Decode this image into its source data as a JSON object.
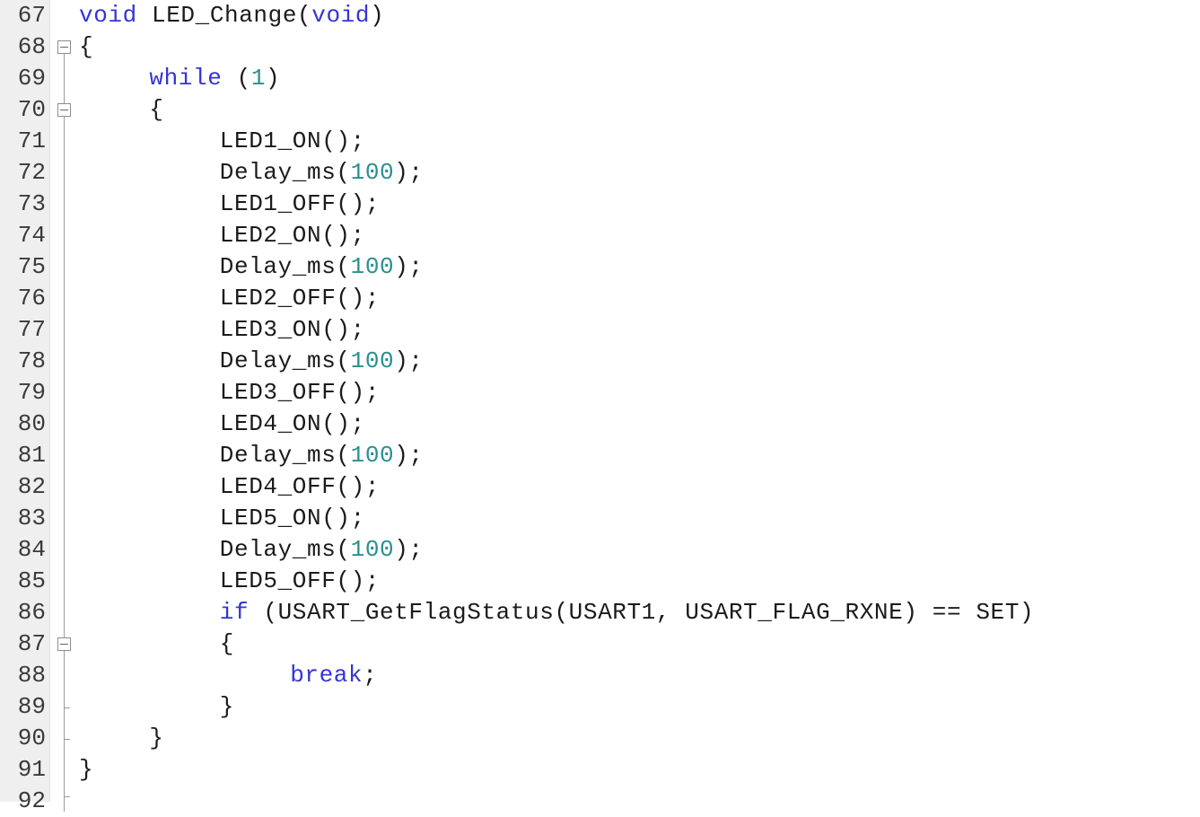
{
  "editor": {
    "title": "C source code editor view",
    "language": "C",
    "first_line": 67,
    "last_line": 92,
    "line_height": 35,
    "font_size": 26,
    "colors": {
      "background": "#ffffff",
      "gutter_background": "#efefef",
      "gutter_text": "#3a3a3a",
      "fold_margin_background": "#ffffff",
      "fold_line": "#9a9a9a",
      "keyword": "#3434d6",
      "number": "#2a8f8f",
      "identifier": "#1b1b1b",
      "punctuation": "#1b1b1b"
    }
  },
  "lines": [
    {
      "number": "67",
      "indent": 0,
      "fold": "none",
      "tokens": [
        {
          "t": "void",
          "c": "kw"
        },
        {
          "t": " LED_Change",
          "c": "id"
        },
        {
          "t": "(",
          "c": "pun"
        },
        {
          "t": "void",
          "c": "kw"
        },
        {
          "t": ")",
          "c": "pun"
        }
      ]
    },
    {
      "number": "68",
      "indent": 0,
      "fold": "box",
      "tokens": [
        {
          "t": "{",
          "c": "pun"
        }
      ]
    },
    {
      "number": "69",
      "indent": 4,
      "fold": "line",
      "tokens": [
        {
          "t": "while",
          "c": "kw"
        },
        {
          "t": " (",
          "c": "pun"
        },
        {
          "t": "1",
          "c": "num"
        },
        {
          "t": ")",
          "c": "pun"
        }
      ]
    },
    {
      "number": "70",
      "indent": 4,
      "fold": "box",
      "tokens": [
        {
          "t": "{",
          "c": "pun"
        }
      ]
    },
    {
      "number": "71",
      "indent": 8,
      "fold": "line",
      "tokens": [
        {
          "t": "LED1_ON",
          "c": "id"
        },
        {
          "t": "();",
          "c": "pun"
        }
      ]
    },
    {
      "number": "72",
      "indent": 8,
      "fold": "line",
      "tokens": [
        {
          "t": "Delay_ms",
          "c": "id"
        },
        {
          "t": "(",
          "c": "pun"
        },
        {
          "t": "100",
          "c": "num"
        },
        {
          "t": ");",
          "c": "pun"
        }
      ]
    },
    {
      "number": "73",
      "indent": 8,
      "fold": "line",
      "tokens": [
        {
          "t": "LED1_OFF",
          "c": "id"
        },
        {
          "t": "();",
          "c": "pun"
        }
      ]
    },
    {
      "number": "74",
      "indent": 8,
      "fold": "line",
      "tokens": [
        {
          "t": "LED2_ON",
          "c": "id"
        },
        {
          "t": "();",
          "c": "pun"
        }
      ]
    },
    {
      "number": "75",
      "indent": 8,
      "fold": "line",
      "tokens": [
        {
          "t": "Delay_ms",
          "c": "id"
        },
        {
          "t": "(",
          "c": "pun"
        },
        {
          "t": "100",
          "c": "num"
        },
        {
          "t": ");",
          "c": "pun"
        }
      ]
    },
    {
      "number": "76",
      "indent": 8,
      "fold": "line",
      "tokens": [
        {
          "t": "LED2_OFF",
          "c": "id"
        },
        {
          "t": "();",
          "c": "pun"
        }
      ]
    },
    {
      "number": "77",
      "indent": 8,
      "fold": "line",
      "tokens": [
        {
          "t": "LED3_ON",
          "c": "id"
        },
        {
          "t": "();",
          "c": "pun"
        }
      ]
    },
    {
      "number": "78",
      "indent": 8,
      "fold": "line",
      "tokens": [
        {
          "t": "Delay_ms",
          "c": "id"
        },
        {
          "t": "(",
          "c": "pun"
        },
        {
          "t": "100",
          "c": "num"
        },
        {
          "t": ");",
          "c": "pun"
        }
      ]
    },
    {
      "number": "79",
      "indent": 8,
      "fold": "line",
      "tokens": [
        {
          "t": "LED3_OFF",
          "c": "id"
        },
        {
          "t": "();",
          "c": "pun"
        }
      ]
    },
    {
      "number": "80",
      "indent": 8,
      "fold": "line",
      "tokens": [
        {
          "t": "LED4_ON",
          "c": "id"
        },
        {
          "t": "();",
          "c": "pun"
        }
      ]
    },
    {
      "number": "81",
      "indent": 8,
      "fold": "line",
      "tokens": [
        {
          "t": "Delay_ms",
          "c": "id"
        },
        {
          "t": "(",
          "c": "pun"
        },
        {
          "t": "100",
          "c": "num"
        },
        {
          "t": ");",
          "c": "pun"
        }
      ]
    },
    {
      "number": "82",
      "indent": 8,
      "fold": "line",
      "tokens": [
        {
          "t": "LED4_OFF",
          "c": "id"
        },
        {
          "t": "();",
          "c": "pun"
        }
      ]
    },
    {
      "number": "83",
      "indent": 8,
      "fold": "line",
      "tokens": [
        {
          "t": "LED5_ON",
          "c": "id"
        },
        {
          "t": "();",
          "c": "pun"
        }
      ]
    },
    {
      "number": "84",
      "indent": 8,
      "fold": "line",
      "tokens": [
        {
          "t": "Delay_ms",
          "c": "id"
        },
        {
          "t": "(",
          "c": "pun"
        },
        {
          "t": "100",
          "c": "num"
        },
        {
          "t": ");",
          "c": "pun"
        }
      ]
    },
    {
      "number": "85",
      "indent": 8,
      "fold": "line",
      "tokens": [
        {
          "t": "LED5_OFF",
          "c": "id"
        },
        {
          "t": "();",
          "c": "pun"
        }
      ]
    },
    {
      "number": "86",
      "indent": 8,
      "fold": "line",
      "tokens": [
        {
          "t": "if",
          "c": "kw"
        },
        {
          "t": " (",
          "c": "pun"
        },
        {
          "t": "USART_GetFlagStatus",
          "c": "id"
        },
        {
          "t": "(",
          "c": "pun"
        },
        {
          "t": "USART1",
          "c": "id"
        },
        {
          "t": ", ",
          "c": "pun"
        },
        {
          "t": "USART_FLAG_RXNE",
          "c": "id"
        },
        {
          "t": ") == ",
          "c": "pun"
        },
        {
          "t": "SET",
          "c": "id"
        },
        {
          "t": ")",
          "c": "pun"
        }
      ]
    },
    {
      "number": "87",
      "indent": 8,
      "fold": "box",
      "tokens": [
        {
          "t": "{",
          "c": "pun"
        }
      ]
    },
    {
      "number": "88",
      "indent": 12,
      "fold": "line",
      "tokens": [
        {
          "t": "break",
          "c": "kw"
        },
        {
          "t": ";",
          "c": "pun"
        }
      ]
    },
    {
      "number": "89",
      "indent": 8,
      "fold": "tick",
      "tokens": [
        {
          "t": "}",
          "c": "pun"
        }
      ]
    },
    {
      "number": "90",
      "indent": 4,
      "fold": "tick",
      "tokens": [
        {
          "t": "}",
          "c": "pun"
        }
      ]
    },
    {
      "number": "91",
      "indent": 0,
      "fold": "line",
      "tokens": [
        {
          "t": "}",
          "c": "pun"
        }
      ]
    },
    {
      "number": "92",
      "indent": 0,
      "fold": "end",
      "tokens": []
    }
  ]
}
